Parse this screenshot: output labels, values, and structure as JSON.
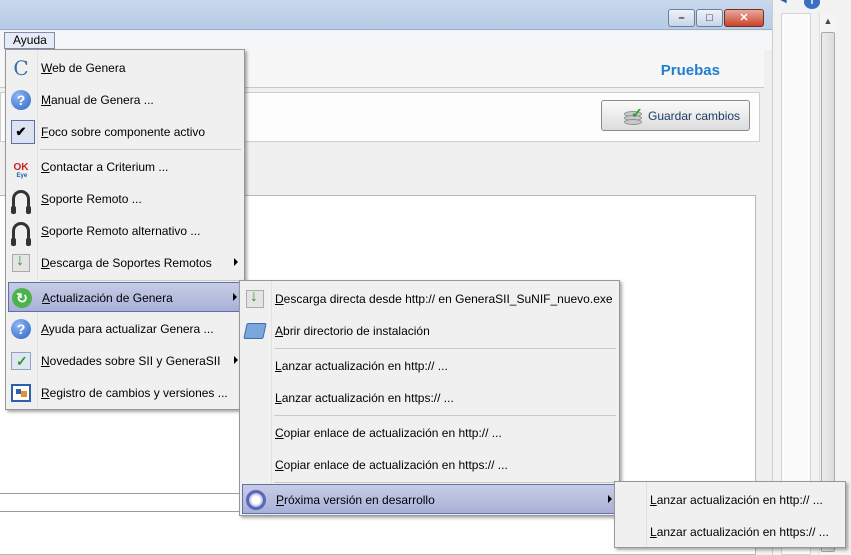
{
  "window": {
    "min_glyph": "–",
    "max_glyph": "□",
    "close_glyph": "✕"
  },
  "menubar": {
    "ayuda": "Ayuda"
  },
  "header": {
    "title": "Pruebas"
  },
  "toolbar": {
    "save_label": "Guardar cambios"
  },
  "right_strip": {
    "info_glyph": "i",
    "arrow_glyph": "◀",
    "scroll_up_glyph": "▲"
  },
  "help_menu": {
    "items": [
      {
        "label": "Web de Genera",
        "icon": "genera-logo-icon",
        "glyph": "C"
      },
      {
        "label": "Manual de Genera ...",
        "icon": "help-icon",
        "glyph": "?"
      },
      {
        "label": "Foco sobre componente activo",
        "icon": "checkmark-icon",
        "glyph": "✔",
        "checked": true
      },
      {
        "label": "Contactar a Criterium ...",
        "icon": "ok-eye-icon",
        "glyph": "OK"
      },
      {
        "label": "Soporte Remoto ...",
        "icon": "headset-icon"
      },
      {
        "label": "Soporte Remoto alternativo ...",
        "icon": "headset-icon"
      },
      {
        "label": "Descarga de Soportes Remotos",
        "icon": "download-icon",
        "submenu": true
      },
      {
        "label": "Actualización de Genera",
        "icon": "refresh-icon",
        "glyph": "↻",
        "submenu": true,
        "selected": true
      },
      {
        "label": "Ayuda para actualizar Genera ...",
        "icon": "help-icon",
        "glyph": "?"
      },
      {
        "label": "Novedades sobre SII y GeneraSII",
        "icon": "news-icon",
        "submenu": true
      },
      {
        "label": "Registro de cambios y versiones ...",
        "icon": "changelog-icon"
      }
    ]
  },
  "update_menu": {
    "items": [
      {
        "label": "Descarga directa desde http:// en GeneraSII_SuNIF_nuevo.exe",
        "icon": "download-icon"
      },
      {
        "label": "Abrir directorio de instalación",
        "icon": "folder-icon"
      },
      {
        "label": "Lanzar actualización en http:// ..."
      },
      {
        "label": "Lanzar actualización en https:// ..."
      },
      {
        "label": "Copiar enlace de actualización en http:// ..."
      },
      {
        "label": "Copiar enlace de actualización en https:// ..."
      },
      {
        "label": "Próxima versión en desarrollo",
        "icon": "dev-version-icon",
        "submenu": true,
        "selected": true
      }
    ]
  },
  "dev_menu": {
    "items": [
      {
        "label": "Lanzar actualización en http:// ..."
      },
      {
        "label": "Lanzar actualización en https:// ..."
      }
    ]
  }
}
